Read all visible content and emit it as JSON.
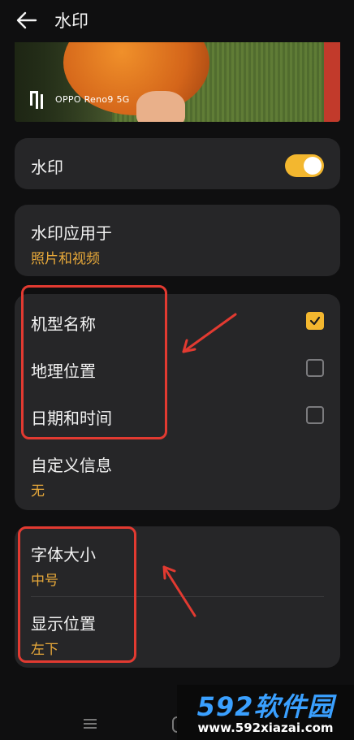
{
  "header": {
    "title": "水印",
    "back_icon": "arrow-left-icon"
  },
  "preview": {
    "watermark_text": "OPPO Reno9 5G",
    "watermark_logo": "oppo-logo"
  },
  "watermark_toggle": {
    "label": "水印",
    "enabled": true
  },
  "apply_to": {
    "label": "水印应用于",
    "value": "照片和视频"
  },
  "watermark_items": [
    {
      "label": "机型名称",
      "checked": true
    },
    {
      "label": "地理位置",
      "checked": false
    },
    {
      "label": "日期和时间",
      "checked": false
    }
  ],
  "custom_info": {
    "label": "自定义信息",
    "value": "无"
  },
  "font_size": {
    "label": "字体大小",
    "value": "中号"
  },
  "position": {
    "label": "显示位置",
    "value": "左下"
  },
  "colors": {
    "accent": "#f3b72f",
    "accent_text": "#e8a93a",
    "annotation": "#e23a31",
    "card": "#262628",
    "background": "#0f0f10"
  },
  "site_logo": {
    "brand": "592软件园",
    "url": "www.592xiazai.com"
  }
}
